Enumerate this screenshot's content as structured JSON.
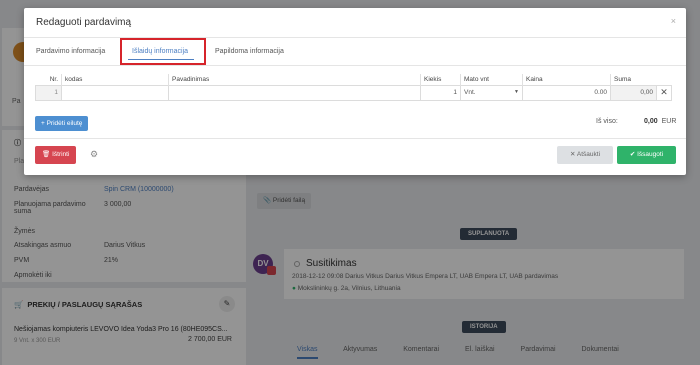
{
  "background": {
    "left_info": [
      {
        "label": "Pardavėjas",
        "value": "Spin CRM (10000000)"
      },
      {
        "label": "Planuojama pardavimo suma",
        "value": "3 000,00"
      },
      {
        "label": "Žymės",
        "value": ""
      },
      {
        "label": "Atsakingas asmuo",
        "value": "Darius Vitkus"
      },
      {
        "label": "PVM",
        "value": "21%"
      },
      {
        "label": "Apmokėti iki",
        "value": ""
      }
    ],
    "products_header": "PREKIŲ / PASLAUGŲ SĄRAŠAS",
    "product": {
      "name": "Nešiojamas kompiuteris LEVOVO Idea Yoda3 Pro 16 (80HE095CS...",
      "sub": "9 Vnt. x 300 EUR",
      "price": "2 700,00 EUR"
    },
    "add_file_button": "Pridėti failą",
    "planned_label": "SUPLANUOTA",
    "history_label": "ISTORIJA",
    "meeting": {
      "avatar_initials": "DV",
      "title": "Susitikimas",
      "meta": "2018-12-12 09:08   Darius Vitkus   Darius Vitkus   Empera LT, UAB   Empera LT, UAB pardavimas",
      "place": "Mokslininkų g. 2a, Vilnius, Lithuania"
    },
    "bottom_tabs": [
      "Viskas",
      "Aktyvumas",
      "Komentarai",
      "El. laiškai",
      "Pardavimai",
      "Dokumentai"
    ]
  },
  "modal": {
    "title": "Redaguoti pardavimą",
    "close_glyph": "×",
    "tabs": [
      {
        "label": "Pardavimo informacija",
        "active": false
      },
      {
        "label": "Išlaidų informacija",
        "active": true
      },
      {
        "label": "Papildoma informacija",
        "active": false
      }
    ],
    "table": {
      "headers": [
        "Nr.",
        "kodas",
        "Pavadinimas",
        "Kiekis",
        "Mato vnt",
        "Kaina",
        "Suma"
      ],
      "rows": [
        {
          "nr": "1",
          "kodas": "",
          "pavadinimas": "",
          "kiekis": "1",
          "mato_vnt": "Vnt.",
          "kaina": "0.00",
          "suma": "0,00"
        }
      ]
    },
    "add_row_button": "+ Pridėti eilutę",
    "total_label": "Iš viso:",
    "total_value": "0,00",
    "total_currency": "EUR",
    "delete_button": "Ištrinti",
    "cancel_button": "Atšaukti",
    "save_button": "Išsaugoti"
  },
  "colors": {
    "accent": "#4d7fc2",
    "highlight_border": "#d6242b",
    "danger": "#d64550",
    "success": "#2fb36a"
  }
}
